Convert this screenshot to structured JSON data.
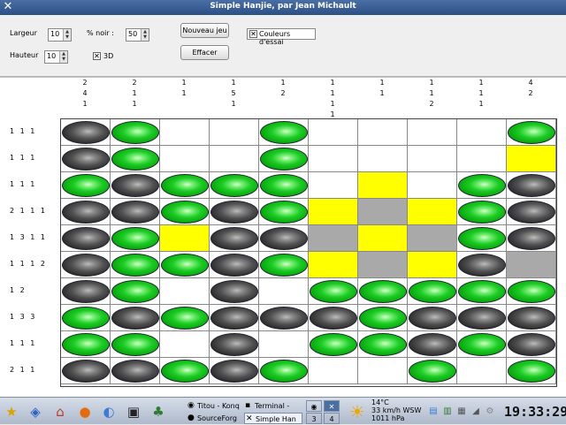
{
  "window": {
    "title": "Simple Hanjie, par Jean Michault",
    "icon": "x-icon"
  },
  "controls": {
    "width_label": "Largeur",
    "width_value": "10",
    "height_label": "Hauteur",
    "height_value": "10",
    "black_pct_label": "% noir :",
    "black_pct_value": "50",
    "threed_label": "3D",
    "threed_checked": true,
    "new_game_label": "Nouveau jeu",
    "clear_label": "Effacer",
    "trial_colors_label": "Couleurs d'essai",
    "trial_colors_checked": true
  },
  "puzzle": {
    "column_clues": [
      [
        "2",
        "4",
        "1"
      ],
      [
        "2",
        "1",
        "1"
      ],
      [
        "1",
        "1"
      ],
      [
        "1",
        "5",
        "1"
      ],
      [
        "1",
        "2"
      ],
      [
        "1",
        "1",
        "1",
        "1"
      ],
      [
        "1",
        "1"
      ],
      [
        "1",
        "1",
        "2"
      ],
      [
        "1",
        "1",
        "1"
      ],
      [
        "4",
        "2"
      ]
    ],
    "row_clues": [
      "1 1 1",
      "1 1 1",
      "1 1 1",
      "2 1 1 1",
      "1 3 1 1",
      "1 1 1 2",
      "1 2",
      "1 3 3",
      "1 1 1",
      "2 1 1"
    ],
    "legend": {
      "B": "black oval",
      "G": "green oval",
      "Y": "yellow cell",
      "X": "gray cell",
      ".": "empty cell"
    },
    "cells": [
      "BG..G....G",
      "BG..G....Y",
      "GBGGG.Y.GB",
      "BBGBGYXYGB",
      "BGYBBXYXGB",
      "BGGBGYXYBX",
      "BG.B.GGGGG",
      "GBGBBBGBBB",
      "GG.B.GGBGB",
      "BBGBG..G.G"
    ]
  },
  "taskbar": {
    "tasks": [
      "Titou - Konq",
      "Terminal -",
      "SourceForg",
      "Simple Han"
    ],
    "pager": [
      "3",
      "4"
    ],
    "weather": {
      "temp": "14°C",
      "wind": "33 km/h WSW",
      "pressure": "1011 hPa"
    },
    "clock": "19:33:29",
    "launchers": [
      "kde-star-icon",
      "kde-menu-icon",
      "home-icon",
      "firefox-icon",
      "network-icon",
      "terminal-icon",
      "people-icon"
    ]
  }
}
